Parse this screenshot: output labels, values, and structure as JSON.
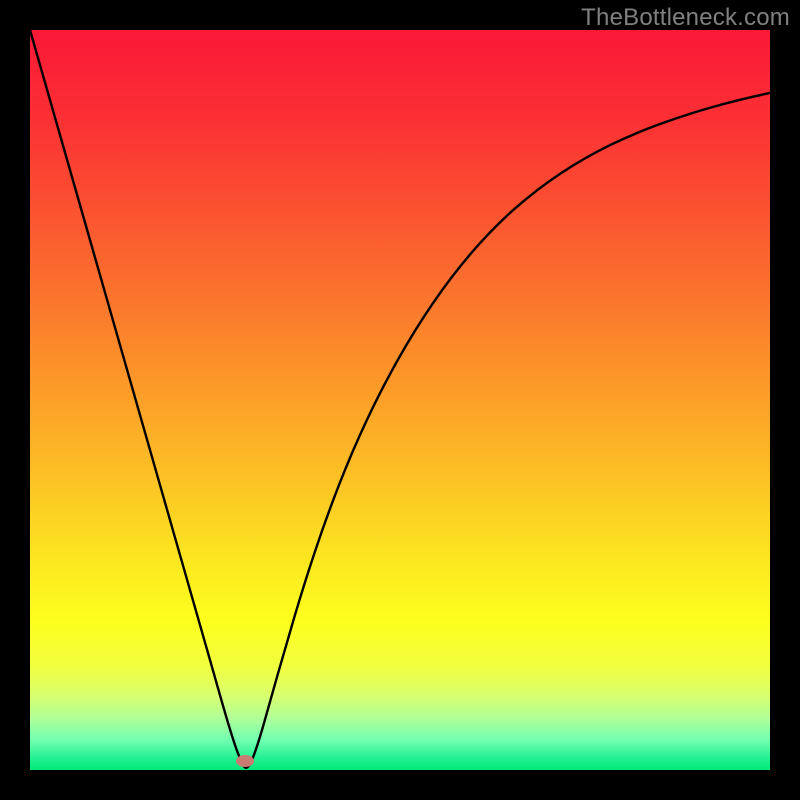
{
  "watermark": "TheBottleneck.com",
  "marker": {
    "x_frac": 0.29,
    "y_frac": 0.988,
    "color": "#c97a73"
  },
  "gradient_stops": [
    {
      "offset": 0.0,
      "color": "#fa1837"
    },
    {
      "offset": 0.12,
      "color": "#fb3034"
    },
    {
      "offset": 0.25,
      "color": "#fb5430"
    },
    {
      "offset": 0.38,
      "color": "#fb7a2c"
    },
    {
      "offset": 0.5,
      "color": "#fca028"
    },
    {
      "offset": 0.62,
      "color": "#fcc624"
    },
    {
      "offset": 0.72,
      "color": "#fce820"
    },
    {
      "offset": 0.8,
      "color": "#feff1e"
    },
    {
      "offset": 0.86,
      "color": "#f2ff40"
    },
    {
      "offset": 0.9,
      "color": "#d8ff70"
    },
    {
      "offset": 0.93,
      "color": "#b0ff98"
    },
    {
      "offset": 0.96,
      "color": "#70ffb0"
    },
    {
      "offset": 0.985,
      "color": "#20f090"
    },
    {
      "offset": 1.0,
      "color": "#00e878"
    }
  ],
  "chart_data": {
    "type": "line",
    "title": "",
    "xlabel": "",
    "ylabel": "",
    "xlim": [
      0,
      1
    ],
    "ylim": [
      0,
      1
    ],
    "x": [
      0.0,
      0.03,
      0.06,
      0.09,
      0.12,
      0.15,
      0.18,
      0.21,
      0.23,
      0.25,
      0.265,
      0.278,
      0.286,
      0.291,
      0.296,
      0.302,
      0.312,
      0.325,
      0.345,
      0.37,
      0.4,
      0.435,
      0.475,
      0.52,
      0.57,
      0.625,
      0.685,
      0.75,
      0.82,
      0.9,
      0.96,
      1.0
    ],
    "values": [
      1.0,
      0.895,
      0.79,
      0.685,
      0.58,
      0.475,
      0.37,
      0.265,
      0.195,
      0.125,
      0.072,
      0.03,
      0.01,
      0.002,
      0.005,
      0.018,
      0.048,
      0.095,
      0.165,
      0.25,
      0.34,
      0.43,
      0.515,
      0.595,
      0.668,
      0.732,
      0.785,
      0.828,
      0.862,
      0.89,
      0.906,
      0.915
    ],
    "note": "V-shaped notch curve. y=0 (optimal) at x≈0.29; left branch nearly linear to y≈1 at x=0; right branch rises with decreasing slope toward y≈0.92 at x=1."
  }
}
